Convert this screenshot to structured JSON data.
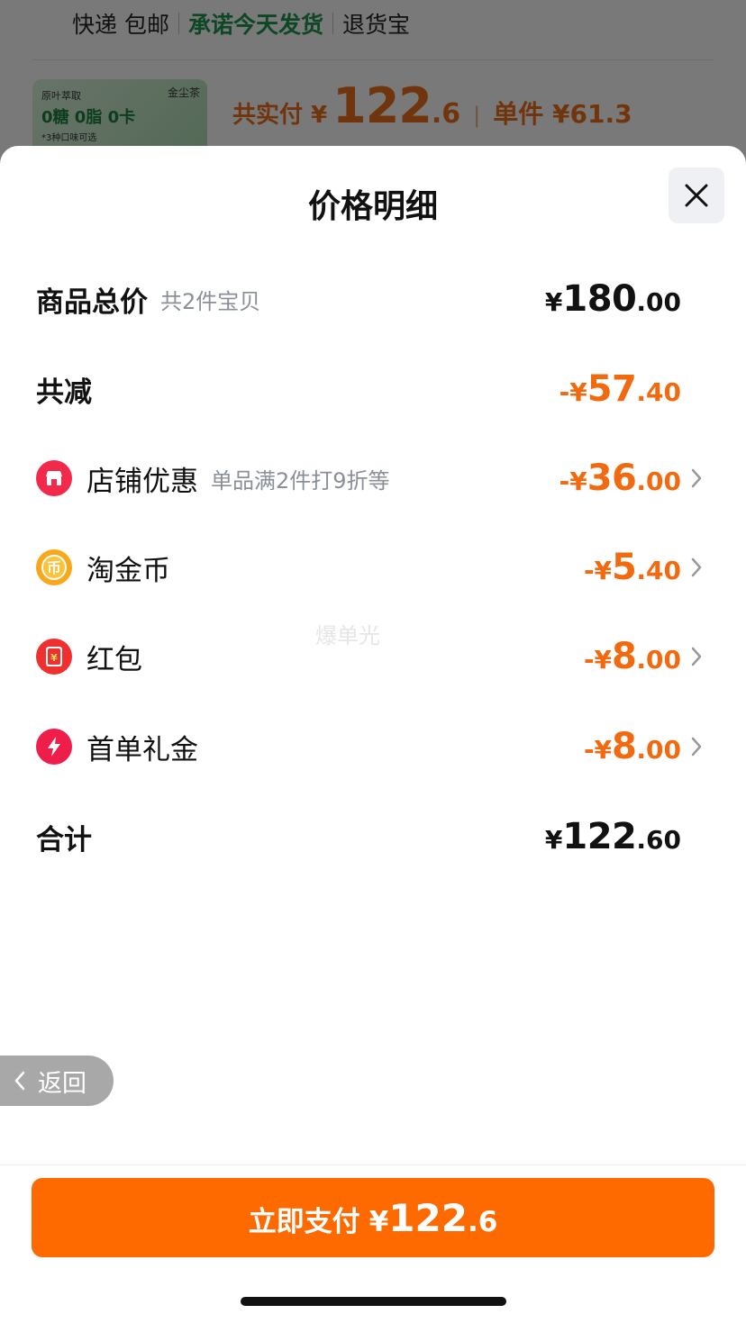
{
  "background": {
    "tags": [
      "快递 包邮",
      "承诺今天发货",
      "退货宝"
    ],
    "thumb": {
      "line1": "原叶萃取",
      "line2": "0糖 0脂 0卡",
      "line3": "*3种口味可选",
      "brand": "金尘茶"
    },
    "price": {
      "label": "共实付 ¥",
      "int": "122",
      "dec": ".6",
      "unit_label": "单件 ¥61.3"
    }
  },
  "sheet": {
    "title": "价格明细",
    "close_icon": "close-icon",
    "rows": [
      {
        "label": "商品总价",
        "sub": "共2件宝贝",
        "pre": "¥",
        "int": "180",
        "dec": ".00",
        "color": "#111111"
      },
      {
        "label": "共减",
        "pre": "-¥",
        "int": "57",
        "dec": ".40",
        "color": "#f26a10"
      },
      {
        "label": "店铺优惠",
        "sub": "单品满2件打9折等",
        "pre": "-¥",
        "int": "36",
        "dec": ".00",
        "icon": "shop-icon",
        "color": "#f26a10"
      },
      {
        "label": "淘金币",
        "pre": "-¥",
        "int": "5",
        "dec": ".40",
        "icon": "coin-icon",
        "color": "#f26a10"
      },
      {
        "label": "红包",
        "pre": "-¥",
        "int": "8",
        "dec": ".00",
        "icon": "red-packet-icon",
        "color": "#f26a10"
      },
      {
        "label": "首单礼金",
        "pre": "-¥",
        "int": "8",
        "dec": ".00",
        "icon": "lightning-icon",
        "color": "#f26a10"
      },
      {
        "label": "合计",
        "pre": "¥",
        "int": "122",
        "dec": ".60",
        "color": "#111111"
      }
    ],
    "watermark": "爆单光",
    "back": "返回",
    "pay": {
      "label": "立即支付",
      "pre": "¥",
      "int": "122",
      "dec": ".6"
    }
  },
  "colors": {
    "accent": "#ff6a00",
    "discount": "#f26a10"
  }
}
